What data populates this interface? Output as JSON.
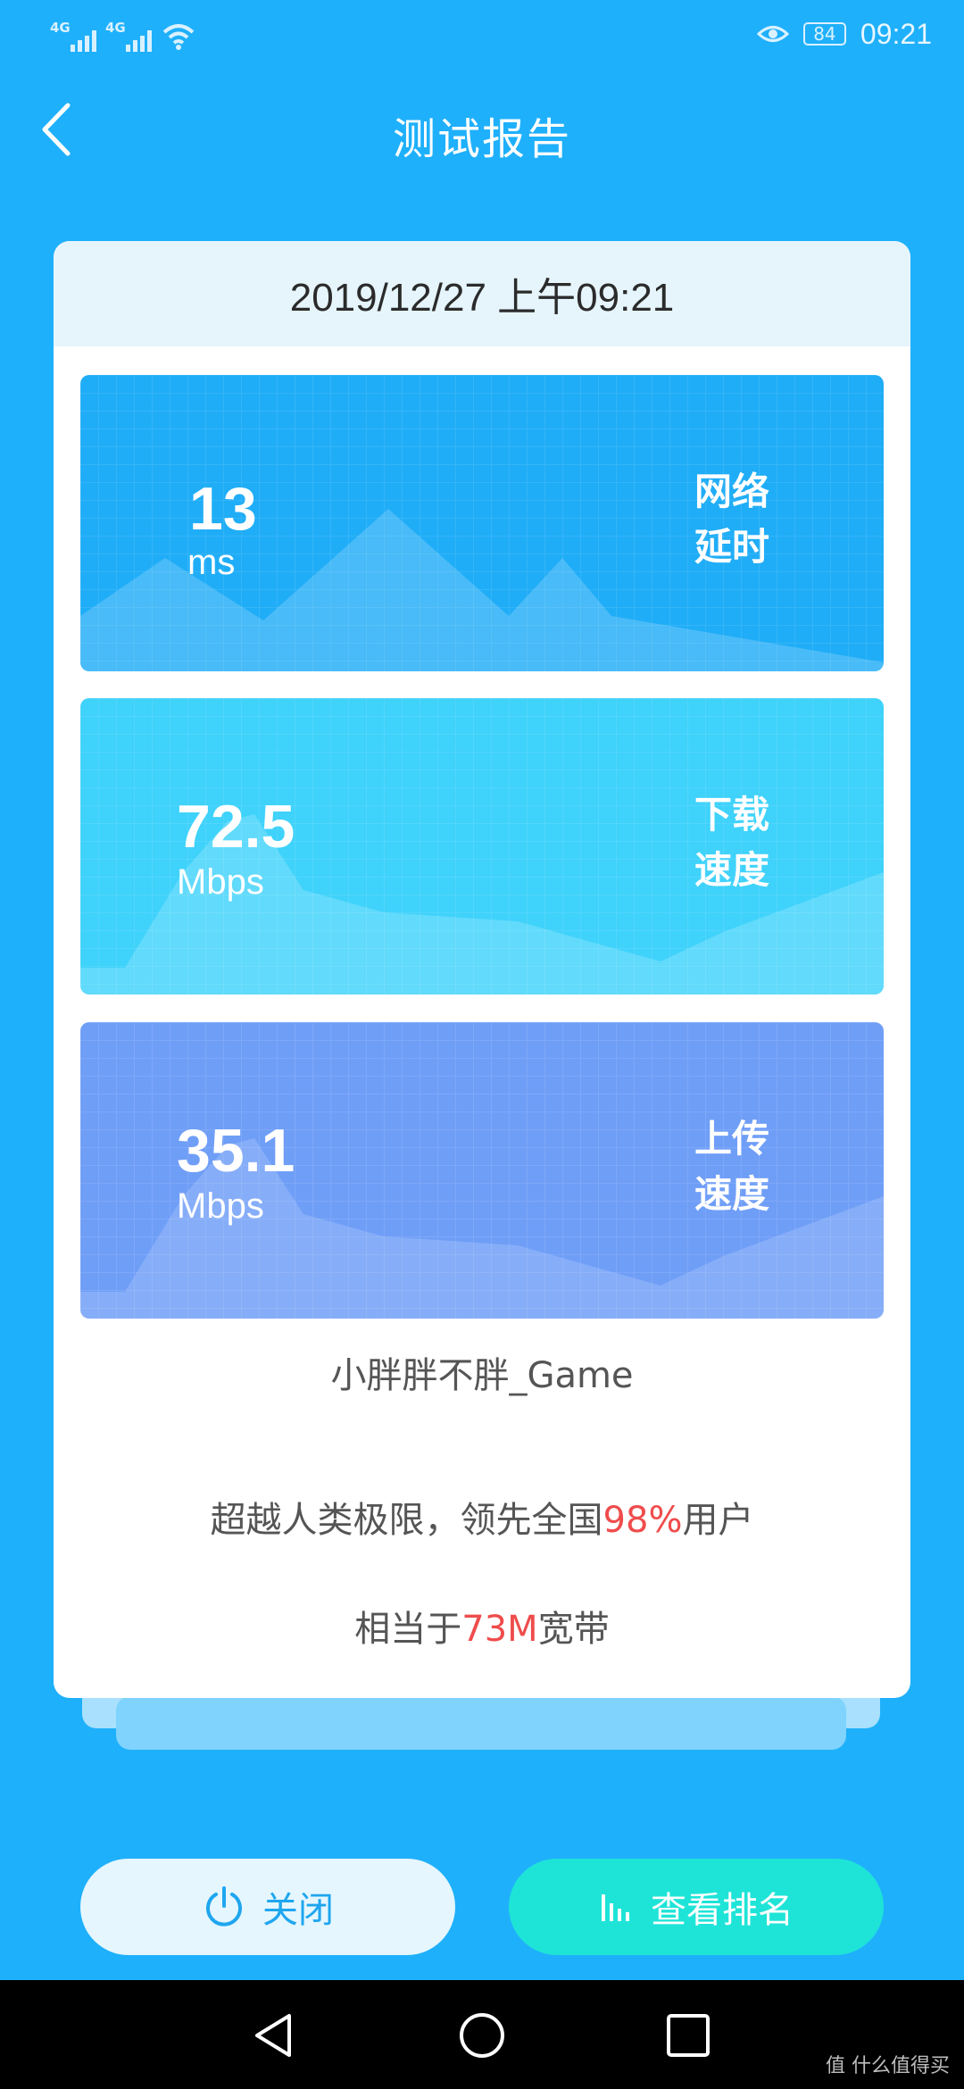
{
  "status_bar": {
    "signal_1": "4G",
    "signal_2": "4G",
    "battery": "84",
    "time": "09:21"
  },
  "header": {
    "title": "测试报告"
  },
  "report": {
    "datetime": "2019/12/27 上午09:21",
    "metrics": [
      {
        "value": "13",
        "unit": "ms",
        "label_line1": "网络",
        "label_line2": "延时",
        "color": "#20adf7"
      },
      {
        "value": "72.5",
        "unit": "Mbps",
        "label_line1": "下载",
        "label_line2": "速度",
        "color": "#3fd2fb"
      },
      {
        "value": "35.1",
        "unit": "Mbps",
        "label_line1": "上传",
        "label_line2": "速度",
        "color": "#6f9ef7"
      }
    ],
    "username": "小胖胖不胖_Game",
    "stat1": {
      "prefix": "超越人类极限，领先全国",
      "highlight": "98%",
      "suffix": "用户"
    },
    "stat2": {
      "prefix": "相当于",
      "highlight": "73M",
      "suffix": "宽带"
    }
  },
  "buttons": {
    "close_label": "关闭",
    "rank_label": "查看排名"
  },
  "nav": {
    "back": "back-icon",
    "home": "home-icon",
    "recents": "recents-icon"
  },
  "watermark": "值 什么值得买"
}
